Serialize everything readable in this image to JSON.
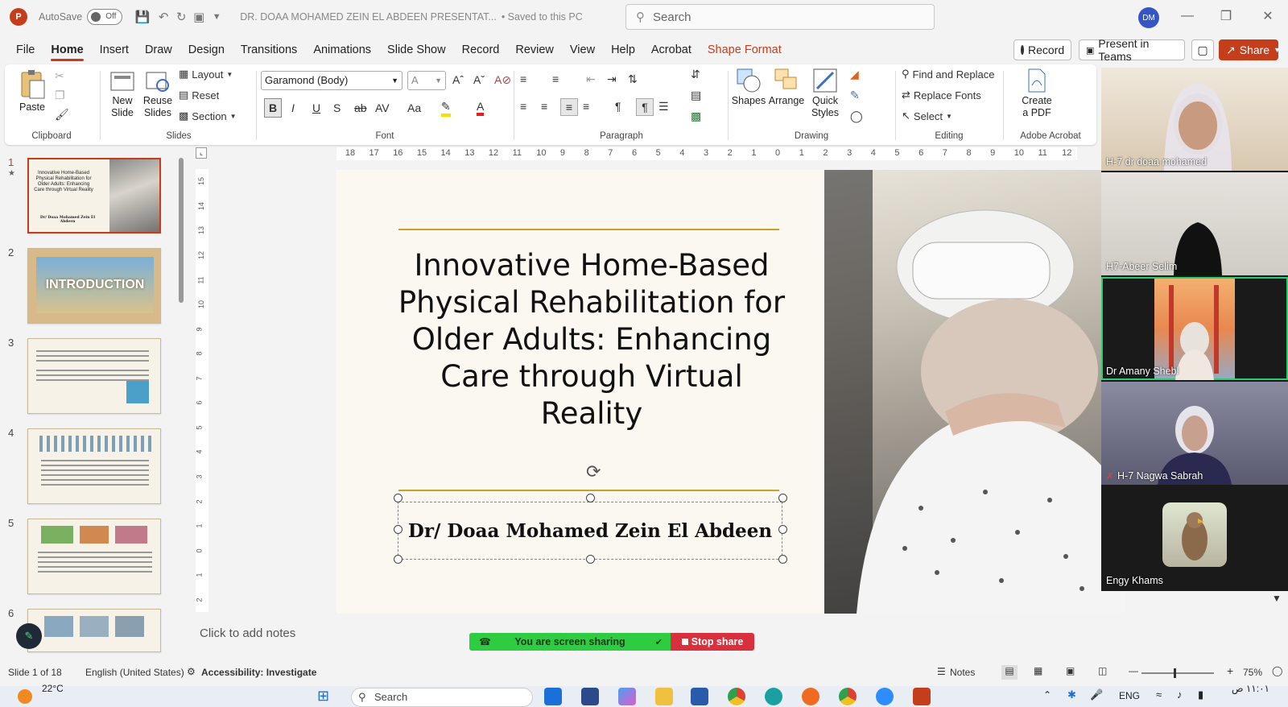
{
  "titlebar": {
    "autosave_label": "AutoSave",
    "autosave_state": "Off",
    "doc_title": "DR. DOAA MOHAMED ZEIN EL ABDEEN PRESENTAT...",
    "save_status": "• Saved to this PC",
    "search_placeholder": "Search",
    "user_initials": "DM"
  },
  "menu": {
    "items": [
      "File",
      "Home",
      "Insert",
      "Draw",
      "Design",
      "Transitions",
      "Animations",
      "Slide Show",
      "Record",
      "Review",
      "View",
      "Help",
      "Acrobat",
      "Shape Format"
    ],
    "record_btn": "Record",
    "teams_btn": "Present in Teams",
    "share_btn": "Share"
  },
  "ribbon": {
    "clipboard": {
      "paste": "Paste",
      "label": "Clipboard"
    },
    "slides": {
      "new_slide": "New",
      "new_slide2": "Slide",
      "reuse": "Reuse",
      "reuse2": "Slides",
      "layout": "Layout",
      "reset": "Reset",
      "section": "Section",
      "label": "Slides"
    },
    "font": {
      "font_name": "Garamond (Body)",
      "label": "Font"
    },
    "paragraph": {
      "label": "Paragraph"
    },
    "drawing": {
      "shapes": "Shapes",
      "arrange": "Arrange",
      "quick": "Quick",
      "styles": "Styles",
      "label": "Drawing"
    },
    "editing": {
      "find": "Find and Replace",
      "replace_fonts": "Replace Fonts",
      "select": "Select",
      "label": "Editing"
    },
    "acrobat": {
      "create": "Create",
      "pdf": "a PDF",
      "label": "Adobe Acrobat"
    }
  },
  "ruler": {
    "h_ticks": [
      "18",
      "17",
      "16",
      "15",
      "14",
      "13",
      "12",
      "11",
      "10",
      "9",
      "8",
      "7",
      "6",
      "5",
      "4",
      "3",
      "2",
      "1",
      "0",
      "1",
      "2",
      "3",
      "4",
      "5",
      "6",
      "7",
      "8",
      "9",
      "10",
      "11",
      "12"
    ],
    "v_ticks": [
      "15",
      "14",
      "13",
      "12",
      "11",
      "10",
      "9",
      "8",
      "7",
      "6",
      "5",
      "4",
      "3",
      "2",
      "1",
      "0",
      "1",
      "2"
    ]
  },
  "thumbnails": {
    "nums": [
      "1",
      "2",
      "3",
      "4",
      "5",
      "6"
    ],
    "slide1_title": "Innovative Home-Based Physical Rehabilitation for Older Adults: Enhancing Care through Virtual Reality",
    "slide1_author": "Dr/ Doaa Mohamed Zein El Abdeen",
    "slide2_title": "INTRODUCTION"
  },
  "slide": {
    "title": "Innovative Home-Based Physical Rehabilitation for Older Adults: Enhancing Care through Virtual Reality",
    "author": "Dr/ Doaa Mohamed Zein El Abdeen",
    "accent": "#c9a227"
  },
  "participants": [
    {
      "name": "H-7 dr doaa mohamed"
    },
    {
      "name": "H7-Abeer Selim"
    },
    {
      "name": "Dr Amany Shebl"
    },
    {
      "name": "H-7 Nagwa Sabrah"
    },
    {
      "name": "Engy Khams"
    }
  ],
  "notes_placeholder": "Click to add notes",
  "share_banner": {
    "text": "You are screen sharing",
    "stop": "Stop share"
  },
  "status": {
    "slide_count": "Slide 1 of 18",
    "language": "English (United States)",
    "accessibility": "Accessibility: Investigate",
    "notes": "Notes",
    "zoom": "75%"
  },
  "taskbar": {
    "temp": "22°C",
    "search": "Search",
    "lang": "ENG",
    "time": "١١:٠١ ص"
  },
  "colors": {
    "accent": "#c43e1c",
    "share_green": "#2ecc40",
    "stop_red": "#d9303e"
  }
}
